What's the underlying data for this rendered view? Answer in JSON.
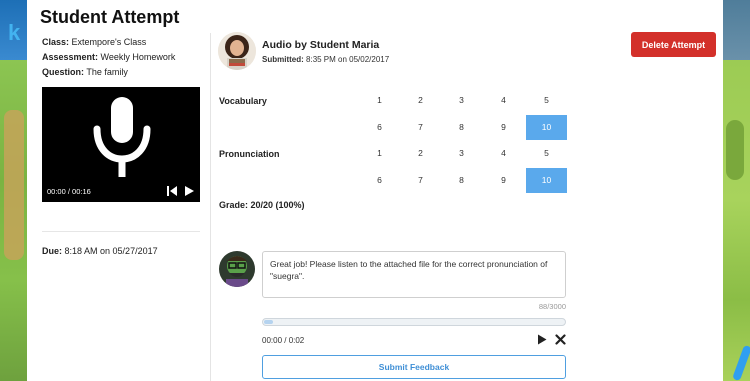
{
  "page": {
    "title": "Student Attempt"
  },
  "attempt_info": {
    "class_label": "Class:",
    "class_value": "Extempore's Class",
    "assessment_label": "Assessment:",
    "assessment_value": "Weekly Homework",
    "question_label": "Question:",
    "question_value": "The family",
    "due_label": "Due:",
    "due_value": "8:18 AM on 05/27/2017"
  },
  "player": {
    "time": "00:00 / 00:16"
  },
  "submission": {
    "title": "Audio by Student Maria",
    "submitted_label": "Submitted:",
    "submitted_value": "8:35 PM on 05/02/2017"
  },
  "actions": {
    "delete_label": "Delete Attempt"
  },
  "rubric": [
    {
      "label": "Vocabulary",
      "options": [
        "1",
        "2",
        "3",
        "4",
        "5",
        "6",
        "7",
        "8",
        "9",
        "10"
      ],
      "selected": "10"
    },
    {
      "label": "Pronunciation",
      "options": [
        "1",
        "2",
        "3",
        "4",
        "5",
        "6",
        "7",
        "8",
        "9",
        "10"
      ],
      "selected": "10"
    }
  ],
  "grade": {
    "text": "Grade: 20/20 (100%)"
  },
  "feedback": {
    "text": "Great job! Please listen to the attached file for the correct pronunciation of \"suegra\".",
    "char_count": "88/3000",
    "recording_time": "00:00 / 0:02",
    "recording_progress": 0.03,
    "submit_label": "Submit Feedback"
  },
  "colors": {
    "delete_button": "#d3302a",
    "selected_score": "#5aa9ec",
    "submit_border": "#4f9fe0"
  }
}
